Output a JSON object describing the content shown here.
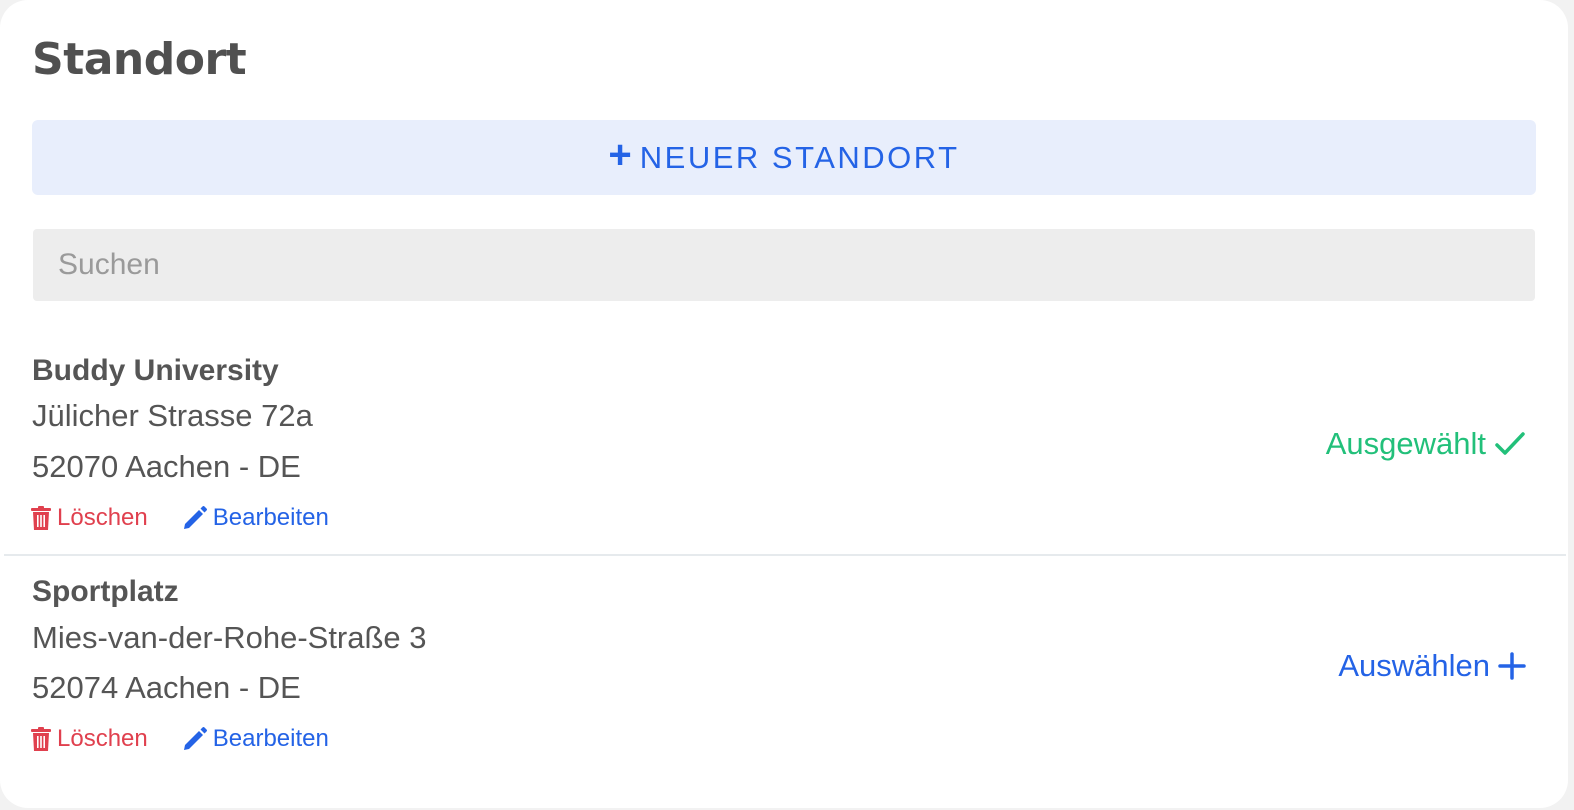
{
  "panel": {
    "title": "Standort",
    "new_button_plus": "+",
    "new_button_label": "NEUER STANDORT",
    "search_placeholder": "Suchen",
    "search_value": ""
  },
  "locations": [
    {
      "name": "Buddy University",
      "street": "Jülicher Strasse 72a",
      "city": "52070 Aachen - DE",
      "delete_label": "Löschen",
      "edit_label": "Bearbeiten",
      "status_label": "Ausgewählt",
      "status_icon": "check-icon",
      "selected": true
    },
    {
      "name": "Sportplatz",
      "street": "Mies-van-der-Rohe-Straße 3",
      "city": "52074 Aachen - DE",
      "delete_label": "Löschen",
      "edit_label": "Bearbeiten",
      "status_label": "Auswählen",
      "status_icon": "plus-icon",
      "selected": false
    }
  ],
  "colors": {
    "accent": "#2463e6",
    "accent_bg": "#e8eefc",
    "success": "#22c07a",
    "danger": "#e0404e",
    "text": "#555555"
  }
}
